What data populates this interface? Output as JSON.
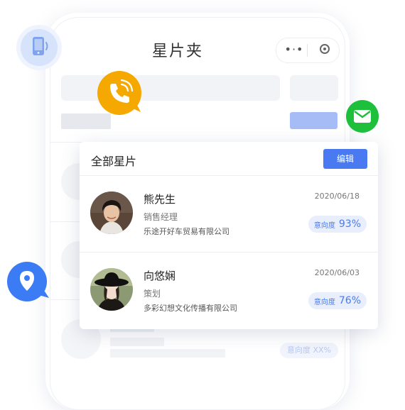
{
  "app": {
    "title": "星片夹",
    "capsule_more": "•·•"
  },
  "card": {
    "title": "全部星片",
    "edit_label": "编辑",
    "contacts": [
      {
        "name": "熊先生",
        "role": "销售经理",
        "company": "乐途开好车贸易有限公司",
        "date": "2020/06/18",
        "intent_label": "意向度",
        "intent_value": "93%"
      },
      {
        "name": "向悠娴",
        "role": "策划",
        "company": "多彩幻想文化传播有限公司",
        "date": "2020/06/03",
        "intent_label": "意向度",
        "intent_value": "76%"
      }
    ]
  },
  "placeholder_row": {
    "intent_text": "意向度 XX%"
  },
  "colors": {
    "accent_blue": "#4a7af2",
    "call_orange": "#f5a800",
    "message_green": "#1dbf3b",
    "location_blue": "#3b7cf5"
  },
  "icons": [
    "phone-device-icon",
    "call-icon",
    "message-icon",
    "location-icon",
    "more-icon",
    "target-icon"
  ]
}
